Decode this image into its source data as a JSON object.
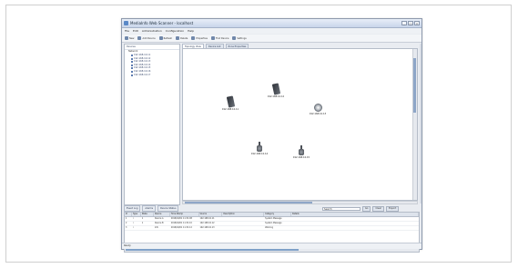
{
  "window": {
    "title": "MediaInfo Web Scanner - localhost",
    "buttons": [
      "_",
      "□",
      "×"
    ]
  },
  "menu": [
    "File",
    "Edit",
    "Administration",
    "Configuration",
    "Help"
  ],
  "toolbar": [
    {
      "label": "New",
      "icon": "new-icon"
    },
    {
      "label": "Add Device",
      "icon": "add-icon"
    },
    {
      "label": "Refresh",
      "icon": "refresh-icon"
    },
    {
      "label": "Delete",
      "icon": "delete-icon"
    },
    {
      "label": "Properties",
      "icon": "properties-icon"
    },
    {
      "label": "Find Device",
      "icon": "find-icon"
    },
    {
      "label": "Settings",
      "icon": "settings-icon"
    }
  ],
  "tree": {
    "header": "Devices",
    "root": "Network",
    "items": [
      "192.168.10.11",
      "192.168.10.12",
      "192.168.10.13",
      "192.168.10.14",
      "192.168.10.15",
      "192.168.10.16",
      "192.168.10.17"
    ]
  },
  "canvas": {
    "tabs": [
      "Topology View",
      "Device List",
      "Zone Properties"
    ]
  },
  "devices": [
    {
      "label": "192.168.10.11",
      "kind": "phone"
    },
    {
      "label": "192.168.10.12",
      "kind": "phone"
    },
    {
      "label": "192.168.10.13",
      "kind": "round"
    },
    {
      "label": "192.168.10.14",
      "kind": "bottle"
    },
    {
      "label": "192.168.10.15",
      "kind": "bottle"
    }
  ],
  "bottom": {
    "tabs": [
      "Event Log",
      "Alarms",
      "Device Status"
    ],
    "filter_placeholder": "Search",
    "filter_buttons": [
      "Go",
      "Clear",
      "Export"
    ]
  },
  "table": {
    "headers": [
      "#",
      "Type",
      "State",
      "Device",
      "Time Stamp",
      "Source",
      "Description",
      "Category",
      "Details"
    ],
    "rows": [
      [
        "1",
        "i",
        "1",
        "Device A",
        "2016/04/01 11:31:08",
        "192.168.10.11",
        "",
        "System Message",
        ""
      ],
      [
        "2",
        "i",
        "1",
        "Device B",
        "2016/04/01 11:31:10",
        "192.168.10.12",
        "",
        "System Message",
        ""
      ],
      [
        "3",
        "i",
        "",
        "Info",
        "2016/04/01 11:31:12",
        "192.168.10.13",
        "",
        "Warning",
        ""
      ]
    ]
  },
  "status": "Ready"
}
